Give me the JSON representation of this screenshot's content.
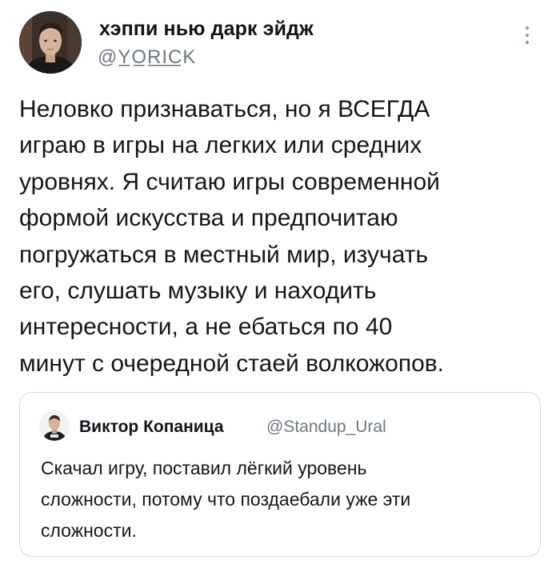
{
  "tweet": {
    "author": {
      "display_name": "хэппи нью дарк эйдж",
      "handle": "@Y̲O̲R̲I̲C̲K"
    },
    "text": "Неловко признаваться, но я ВСЕГДА\nиграю в игры на легких или средних\nуровнях. Я считаю игры современной\nформой искусства и предпочитаю\nпогружаться в местный мир, изучать\nего, слушать музыку и находить\nинтересности, а не ебаться по 40\nминут с очередной стаей волкожопов."
  },
  "quoted": {
    "display_name": "Виктор Копаница",
    "handle": "@Standup_Ural",
    "text": "Скачал игру, поставил лёгкий уровень\nсложности, потому что поздаебали уже эти\nсложности."
  },
  "icons": {
    "more": "more-vertical-icon"
  },
  "colors": {
    "text": "#14171a",
    "secondary": "#6e7781",
    "border": "#d4dadf"
  }
}
